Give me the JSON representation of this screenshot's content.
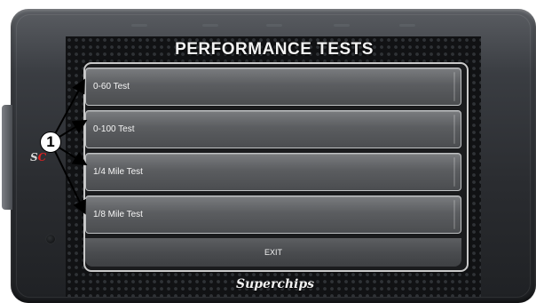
{
  "screen": {
    "title": "PERFORMANCE TESTS",
    "menu_items": [
      {
        "label": "0-60 Test"
      },
      {
        "label": "0-100 Test"
      },
      {
        "label": "1/4 Mile Test"
      },
      {
        "label": "1/8 Mile Test"
      }
    ],
    "exit_label": "EXIT"
  },
  "device": {
    "brand": "Superchips",
    "side_logo_white": "S",
    "side_logo_red": "C"
  },
  "callout": {
    "number": "1"
  },
  "colors": {
    "bezel": "#2a2c30",
    "screen_bg": "#111214",
    "button": "#5b5d60",
    "text": "#f5f5f5",
    "accent_red": "#dd2222"
  }
}
